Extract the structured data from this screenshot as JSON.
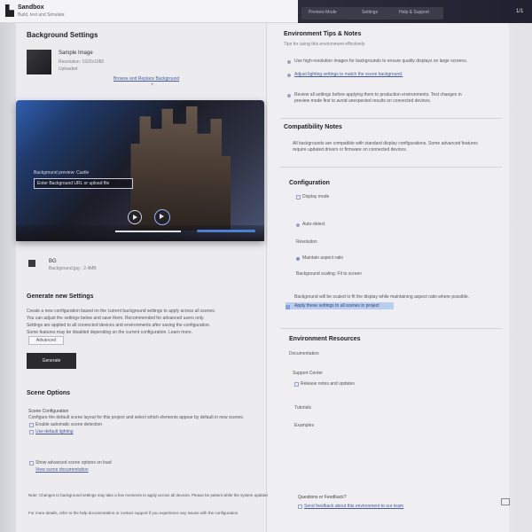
{
  "app": {
    "title": "Sandbox",
    "subtitle": "Build, test and Simulate"
  },
  "topbar": {
    "items": [
      "Preview Mode",
      "Settings",
      "Help & Support"
    ],
    "counter": "1/1"
  },
  "left": {
    "title": "Background Settings",
    "thumb_title": "Sample Image",
    "thumb_sub1": "Resolution: 1920x1080",
    "thumb_sub2": "Uploaded",
    "link_center": "Browse and Replace Background",
    "arrow": "+",
    "video_caption": "Background preview: Castle",
    "video_field": "Enter Background URL or upload file",
    "file_label": "BG",
    "file_sub": "Background.jpg - 2.4MB",
    "section2_title": "Generate new Settings",
    "section2_lines": [
      "Create a new configuration based on the current background settings to apply across all scenes.",
      "You can adjust the settings below and save them. Recommended for advanced users only.",
      "Settings are applied to all connected devices and environments after saving the configuration.",
      "Some features may be disabled depending on the current configuration. Learn more."
    ],
    "chip_label": "Advanced",
    "dark_button": "Generate",
    "section3_title": "Scene Options",
    "s3_label": "Scene Configuration",
    "s3_desc": "Configure the default scene layout for this project and select which elements appear by default in new scenes.",
    "s3_check1": "Enable automatic scene detection",
    "s3_check2": "Use default lighting",
    "s3_check3": "Show advanced scene options on load",
    "s3_link": "View scene documentation",
    "footer_lines": [
      "Note: Changes to background settings may take a few moments to apply across all devices. Please be patient while the system updates.",
      "For more details, refer to the help documentation or contact support if you experience any issues with the configuration."
    ]
  },
  "right": {
    "title": "Environment Tips & Notes",
    "sub": "Tips for using this environment effectively",
    "bullets": [
      "Use high-resolution images for backgrounds to ensure quality displays on large screens.",
      "Adjust lighting settings to match the scene background.",
      "Review all settings before applying them to production environments. Test changes in preview mode first to avoid unexpected results on connected devices."
    ],
    "section2_title": "Compatibility Notes",
    "section2_text": "All backgrounds are compatible with standard display configurations. Some advanced features require updated drivers or firmware on connected devices.",
    "section3_title": "Configuration",
    "cfg_item1": "Display mode",
    "cfg_item2": "Auto-detect",
    "cfg_item3": "Resolution",
    "cfg_item4": "Maintain aspect ratio",
    "cfg_item5": "Background scaling: Fit to screen",
    "cfg_note": "Background will be scaled to fit the display while maintaining aspect ratio where possible.",
    "cfg_highlight": "Apply these settings to all scenes in project",
    "section4_title": "Environment Resources",
    "res1": "Documentation",
    "res2": "Support Center",
    "res3": "Release notes and updates",
    "res4": "Tutorials",
    "res5": "Examples",
    "footer_title": "Questions or Feedback?",
    "footer_link": "Send feedback about this environment to our team"
  }
}
